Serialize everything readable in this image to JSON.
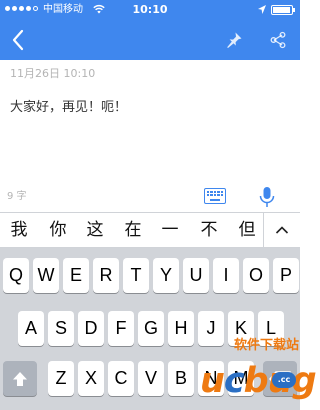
{
  "status_bar": {
    "carrier": "中国移动",
    "time": "10:10",
    "signal_bars_filled": 4,
    "signal_bars_total": 5,
    "icons": [
      "signal-dots-icon",
      "wifi-icon",
      "location-arrow-icon",
      "battery-icon"
    ]
  },
  "colors": {
    "accent": "#3f87ee",
    "keyboard_bg": "#d1d4d9",
    "muted_text": "#b4b4b4",
    "watermark_orange": "#ee7a12",
    "watermark_blue": "#2b6fc4"
  },
  "header": {
    "icons": [
      "back-chevron-icon",
      "pin-icon",
      "share-icon"
    ]
  },
  "note": {
    "date": "11月26日 10:10",
    "body": "大家好，再见！呃！"
  },
  "toolbar": {
    "char_count": "9 字",
    "icons": [
      "keyboard-icon",
      "microphone-icon"
    ]
  },
  "candidates": {
    "words": [
      "我",
      "你",
      "这",
      "在",
      "一",
      "不",
      "但"
    ],
    "icons": [
      "chevron-up-icon"
    ]
  },
  "keyboard": {
    "row1": [
      "Q",
      "W",
      "E",
      "R",
      "T",
      "Y",
      "U",
      "I",
      "O",
      "P"
    ],
    "row2": [
      "A",
      "S",
      "D",
      "F",
      "G",
      "H",
      "J",
      "K",
      "L"
    ],
    "row3": [
      "Z",
      "X",
      "C",
      "V",
      "B",
      "N",
      "M"
    ],
    "icons": [
      "shift-arrow-icon",
      "backspace-icon"
    ]
  },
  "watermark": {
    "logo_u": "u",
    "logo_c": "c",
    "logo_bug": "bug",
    "site_text": "软件下载站",
    "bubble_text": ".cc"
  }
}
